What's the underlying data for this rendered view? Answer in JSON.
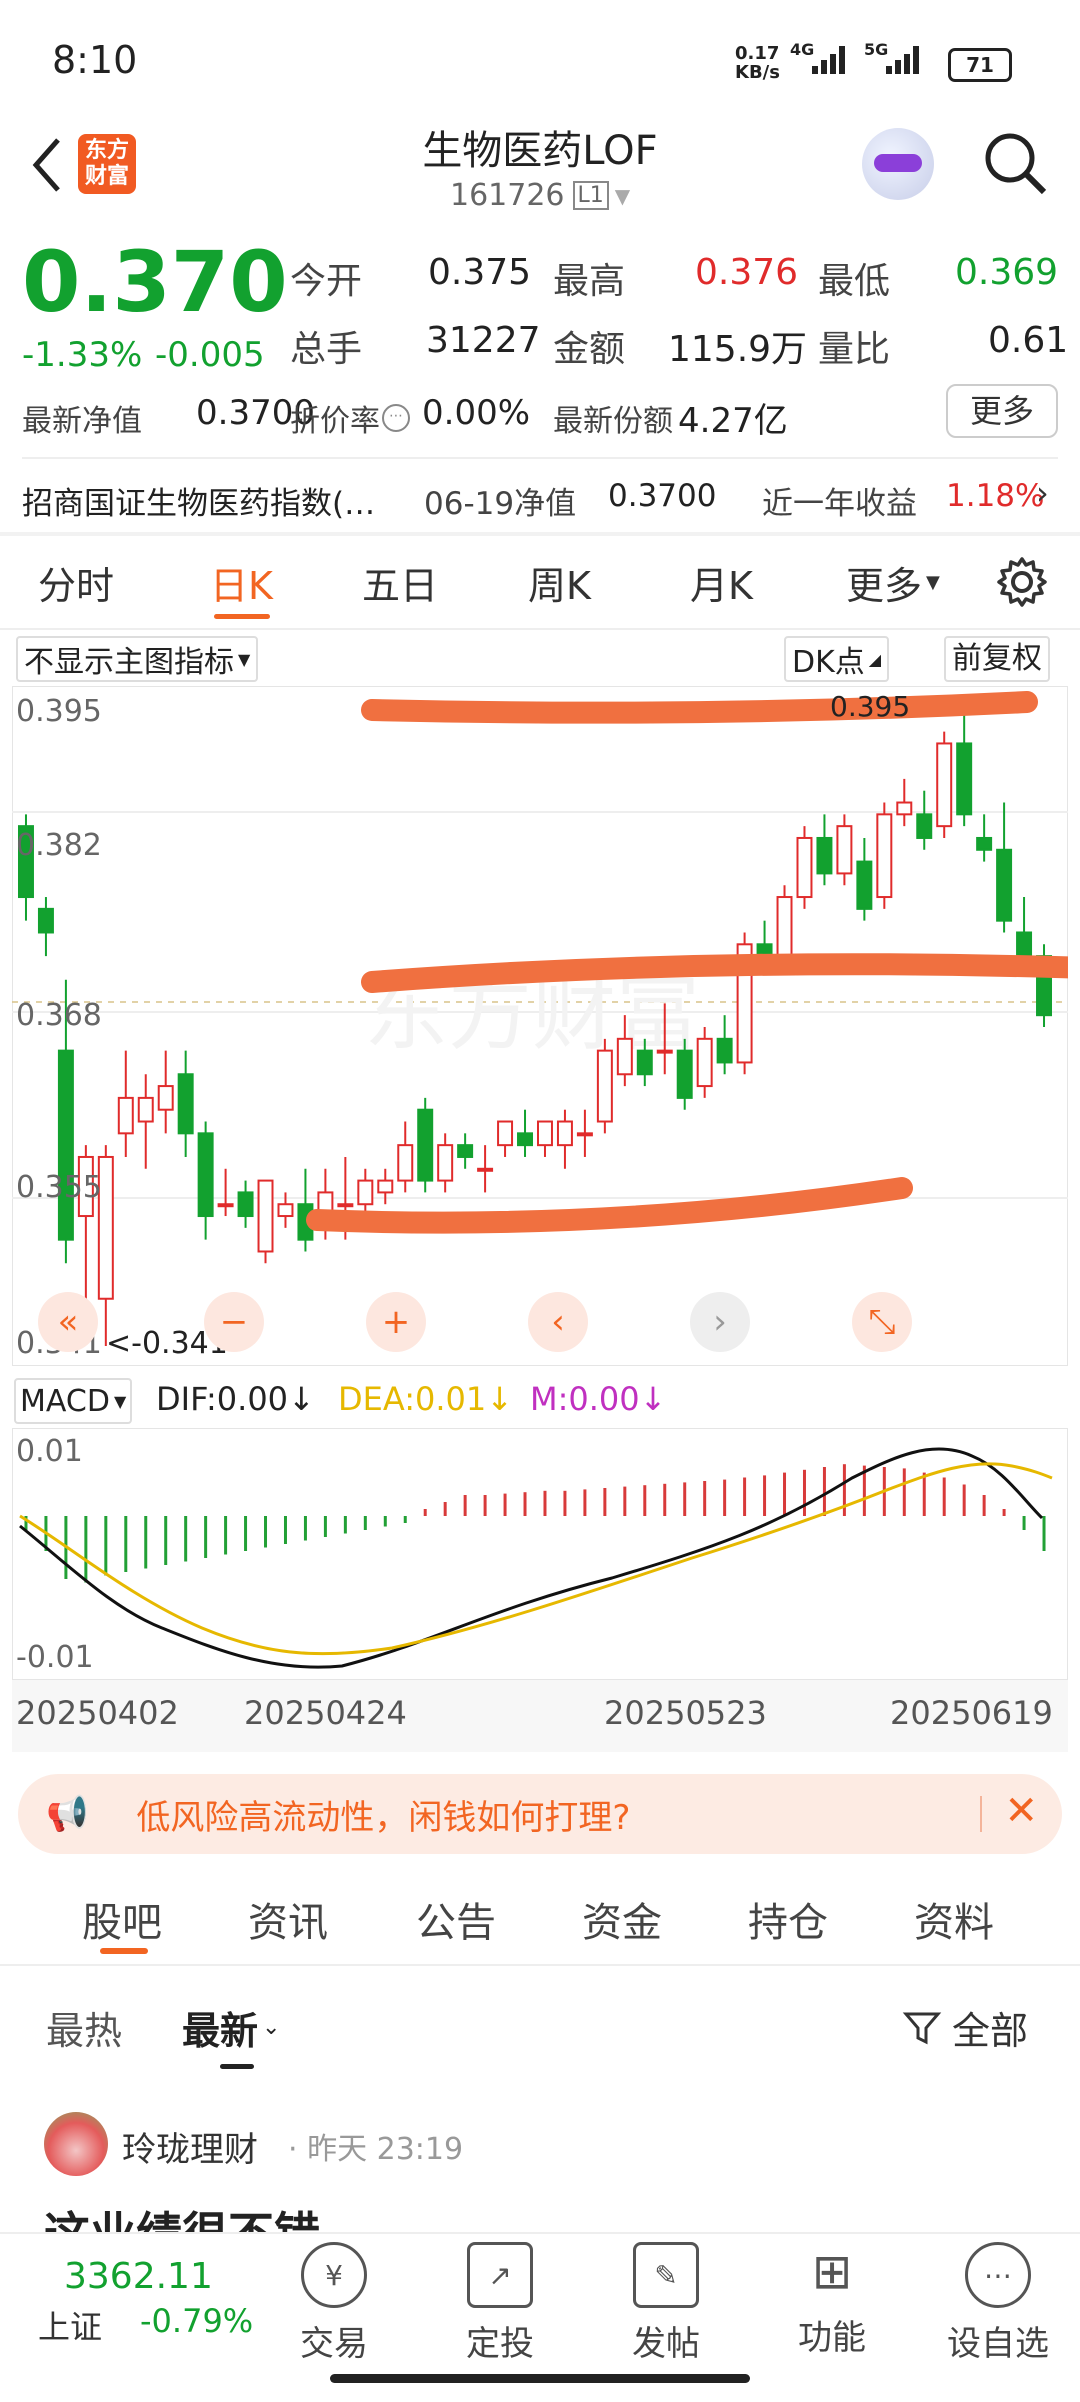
{
  "status": {
    "time": "8:10",
    "speed": "0.17\nKB/s",
    "net1": "4G",
    "net2": "5G",
    "battery": "71"
  },
  "header": {
    "title": "生物医药LOF",
    "code": "161726",
    "level": "L1",
    "logo_text": "东方\n财富"
  },
  "quote": {
    "price": "0.370",
    "change_pct": "-1.33%",
    "change": "-0.005",
    "open_label": "今开",
    "open": "0.375",
    "high_label": "最高",
    "high": "0.376",
    "low_label": "最低",
    "low": "0.369",
    "volume_label": "总手",
    "volume": "31227",
    "amount_label": "金额",
    "amount": "115.9万",
    "ratio_label": "量比",
    "ratio": "0.61",
    "nav_label": "最新净值",
    "nav": "0.3700",
    "discount_label": "折价率",
    "discount": "0.00%",
    "shares_label": "最新份额",
    "shares": "4.27亿",
    "more": "更多"
  },
  "index_row": {
    "index_name": "招商国证生物医药指数(…",
    "nav_date_label": "06-19净值",
    "nav_value": "0.3700",
    "year_label": "近一年收益",
    "year_value": "1.18%"
  },
  "chart_tabs": [
    "分时",
    "日K",
    "五日",
    "周K",
    "月K",
    "更多"
  ],
  "chart_tabs_active": 1,
  "indicator_select": "不显示主图指标",
  "dk_button": "DK点",
  "adjust_button": "前复权",
  "watermark": "东方财富",
  "chart_data": {
    "type": "candlestick",
    "y_ticks": [
      "0.395",
      "0.382",
      "0.368",
      "0.355",
      "0.341"
    ],
    "low_label": "<-0.341",
    "high_label": "0.395",
    "ylim": [
      0.341,
      0.395
    ],
    "candles": [
      {
        "o": 0.385,
        "c": 0.379,
        "h": 0.386,
        "l": 0.377
      },
      {
        "o": 0.378,
        "c": 0.376,
        "h": 0.379,
        "l": 0.374
      },
      {
        "o": 0.366,
        "c": 0.35,
        "h": 0.372,
        "l": 0.348
      },
      {
        "o": 0.352,
        "c": 0.357,
        "h": 0.358,
        "l": 0.345
      },
      {
        "o": 0.345,
        "c": 0.357,
        "h": 0.358,
        "l": 0.341
      },
      {
        "o": 0.359,
        "c": 0.362,
        "h": 0.366,
        "l": 0.357
      },
      {
        "o": 0.36,
        "c": 0.362,
        "h": 0.364,
        "l": 0.356
      },
      {
        "o": 0.361,
        "c": 0.363,
        "h": 0.366,
        "l": 0.359
      },
      {
        "o": 0.364,
        "c": 0.359,
        "h": 0.366,
        "l": 0.357
      },
      {
        "o": 0.359,
        "c": 0.352,
        "h": 0.36,
        "l": 0.35
      },
      {
        "o": 0.353,
        "c": 0.353,
        "h": 0.356,
        "l": 0.352
      },
      {
        "o": 0.354,
        "c": 0.352,
        "h": 0.355,
        "l": 0.351
      },
      {
        "o": 0.349,
        "c": 0.355,
        "h": 0.355,
        "l": 0.348
      },
      {
        "o": 0.352,
        "c": 0.353,
        "h": 0.354,
        "l": 0.351
      },
      {
        "o": 0.353,
        "c": 0.35,
        "h": 0.356,
        "l": 0.349
      },
      {
        "o": 0.351,
        "c": 0.354,
        "h": 0.356,
        "l": 0.35
      },
      {
        "o": 0.353,
        "c": 0.353,
        "h": 0.357,
        "l": 0.35
      },
      {
        "o": 0.353,
        "c": 0.355,
        "h": 0.356,
        "l": 0.352
      },
      {
        "o": 0.354,
        "c": 0.355,
        "h": 0.356,
        "l": 0.353
      },
      {
        "o": 0.355,
        "c": 0.358,
        "h": 0.36,
        "l": 0.354
      },
      {
        "o": 0.361,
        "c": 0.355,
        "h": 0.362,
        "l": 0.354
      },
      {
        "o": 0.355,
        "c": 0.358,
        "h": 0.359,
        "l": 0.354
      },
      {
        "o": 0.358,
        "c": 0.357,
        "h": 0.359,
        "l": 0.356
      },
      {
        "o": 0.356,
        "c": 0.356,
        "h": 0.358,
        "l": 0.354
      },
      {
        "o": 0.358,
        "c": 0.36,
        "h": 0.36,
        "l": 0.357
      },
      {
        "o": 0.359,
        "c": 0.358,
        "h": 0.361,
        "l": 0.357
      },
      {
        "o": 0.358,
        "c": 0.36,
        "h": 0.36,
        "l": 0.357
      },
      {
        "o": 0.358,
        "c": 0.36,
        "h": 0.361,
        "l": 0.356
      },
      {
        "o": 0.359,
        "c": 0.359,
        "h": 0.361,
        "l": 0.357
      },
      {
        "o": 0.36,
        "c": 0.366,
        "h": 0.367,
        "l": 0.359
      },
      {
        "o": 0.364,
        "c": 0.367,
        "h": 0.369,
        "l": 0.363
      },
      {
        "o": 0.366,
        "c": 0.364,
        "h": 0.367,
        "l": 0.363
      },
      {
        "o": 0.366,
        "c": 0.366,
        "h": 0.37,
        "l": 0.364
      },
      {
        "o": 0.366,
        "c": 0.362,
        "h": 0.367,
        "l": 0.361
      },
      {
        "o": 0.363,
        "c": 0.367,
        "h": 0.368,
        "l": 0.362
      },
      {
        "o": 0.367,
        "c": 0.365,
        "h": 0.369,
        "l": 0.364
      },
      {
        "o": 0.365,
        "c": 0.375,
        "h": 0.376,
        "l": 0.364
      },
      {
        "o": 0.375,
        "c": 0.374,
        "h": 0.377,
        "l": 0.373
      },
      {
        "o": 0.374,
        "c": 0.379,
        "h": 0.38,
        "l": 0.373
      },
      {
        "o": 0.379,
        "c": 0.384,
        "h": 0.385,
        "l": 0.378
      },
      {
        "o": 0.384,
        "c": 0.381,
        "h": 0.386,
        "l": 0.38
      },
      {
        "o": 0.381,
        "c": 0.385,
        "h": 0.386,
        "l": 0.38
      },
      {
        "o": 0.382,
        "c": 0.378,
        "h": 0.384,
        "l": 0.377
      },
      {
        "o": 0.379,
        "c": 0.386,
        "h": 0.387,
        "l": 0.378
      },
      {
        "o": 0.386,
        "c": 0.387,
        "h": 0.389,
        "l": 0.385
      },
      {
        "o": 0.386,
        "c": 0.384,
        "h": 0.388,
        "l": 0.383
      },
      {
        "o": 0.385,
        "c": 0.392,
        "h": 0.393,
        "l": 0.384
      },
      {
        "o": 0.392,
        "c": 0.386,
        "h": 0.395,
        "l": 0.385
      },
      {
        "o": 0.384,
        "c": 0.383,
        "h": 0.386,
        "l": 0.382
      },
      {
        "o": 0.383,
        "c": 0.377,
        "h": 0.387,
        "l": 0.376
      },
      {
        "o": 0.376,
        "c": 0.374,
        "h": 0.379,
        "l": 0.373
      },
      {
        "o": 0.374,
        "c": 0.369,
        "h": 0.375,
        "l": 0.368
      }
    ]
  },
  "macd": {
    "select": "MACD",
    "dif_label": "DIF:0.00",
    "dea_label": "DEA:0.01",
    "m_label": "M:0.00",
    "y_top": "0.01",
    "y_bottom": "-0.01",
    "dates": [
      "20250402",
      "20250424",
      "20250523",
      "20250619"
    ],
    "bars": [
      -0.2,
      -0.5,
      -0.9,
      -0.95,
      -0.85,
      -0.8,
      -0.75,
      -0.7,
      -0.65,
      -0.6,
      -0.55,
      -0.5,
      -0.45,
      -0.4,
      -0.35,
      -0.3,
      -0.25,
      -0.2,
      -0.15,
      -0.1,
      0.1,
      0.2,
      0.3,
      0.3,
      0.32,
      0.34,
      0.36,
      0.36,
      0.38,
      0.4,
      0.42,
      0.44,
      0.46,
      0.48,
      0.5,
      0.52,
      0.55,
      0.58,
      0.62,
      0.66,
      0.7,
      0.74,
      0.72,
      0.7,
      0.68,
      0.62,
      0.55,
      0.45,
      0.3,
      0.1,
      -0.2,
      -0.5
    ]
  },
  "banner": {
    "text": "低风险高流动性，闲钱如何打理?"
  },
  "feed_tabs": [
    "股吧",
    "资讯",
    "公告",
    "资金",
    "持仓",
    "资料"
  ],
  "feed_tabs_active": 0,
  "sort": {
    "hot": "最热",
    "latest": "最新",
    "filter": "全部"
  },
  "post": {
    "author": "玲珑理财",
    "time": "昨天 23:19",
    "title": "这业绩很不错"
  },
  "bottom": {
    "index_value": "3362.11",
    "index_name": "上证",
    "index_change": "-0.79%",
    "nav": [
      {
        "label": "交易",
        "icon": "¥"
      },
      {
        "label": "定投",
        "icon": "↗"
      },
      {
        "label": "发帖",
        "icon": "✎"
      },
      {
        "label": "功能",
        "icon": "⊞"
      },
      {
        "label": "设自选",
        "icon": "⋯"
      }
    ]
  }
}
